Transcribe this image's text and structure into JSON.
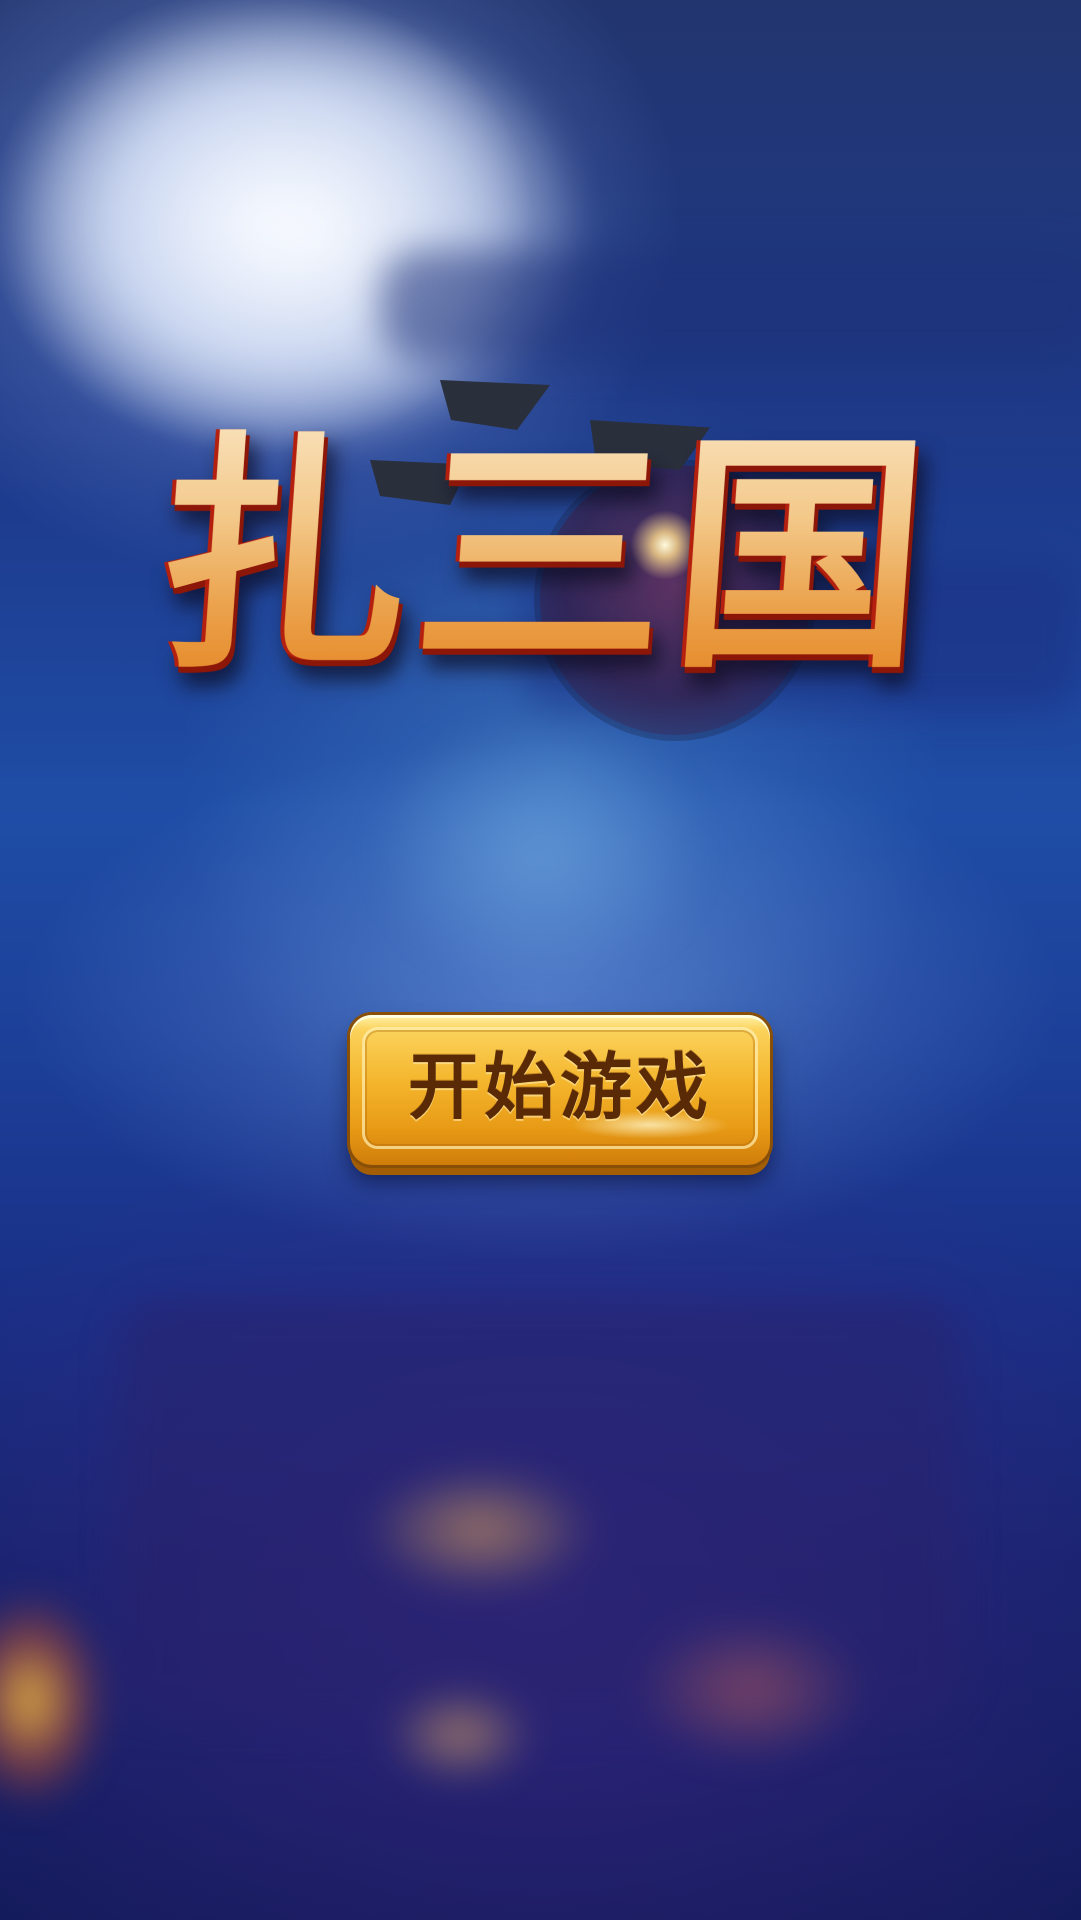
{
  "game": {
    "title": "扎三国"
  },
  "menu": {
    "start_label": "开始游戏"
  },
  "colors": {
    "background_primary": "#1f4da6",
    "background_dark": "#141b5c",
    "moon": "#eef2fb",
    "logo_gold": "#f3c98a",
    "logo_outline_red": "#b5200e",
    "button_gold": "#f4b52c",
    "button_text": "#5a2a06"
  },
  "icons": {
    "moon": "moon-decoration",
    "flags": "war-flag-icon",
    "sparkle": "sparkle-icon"
  }
}
